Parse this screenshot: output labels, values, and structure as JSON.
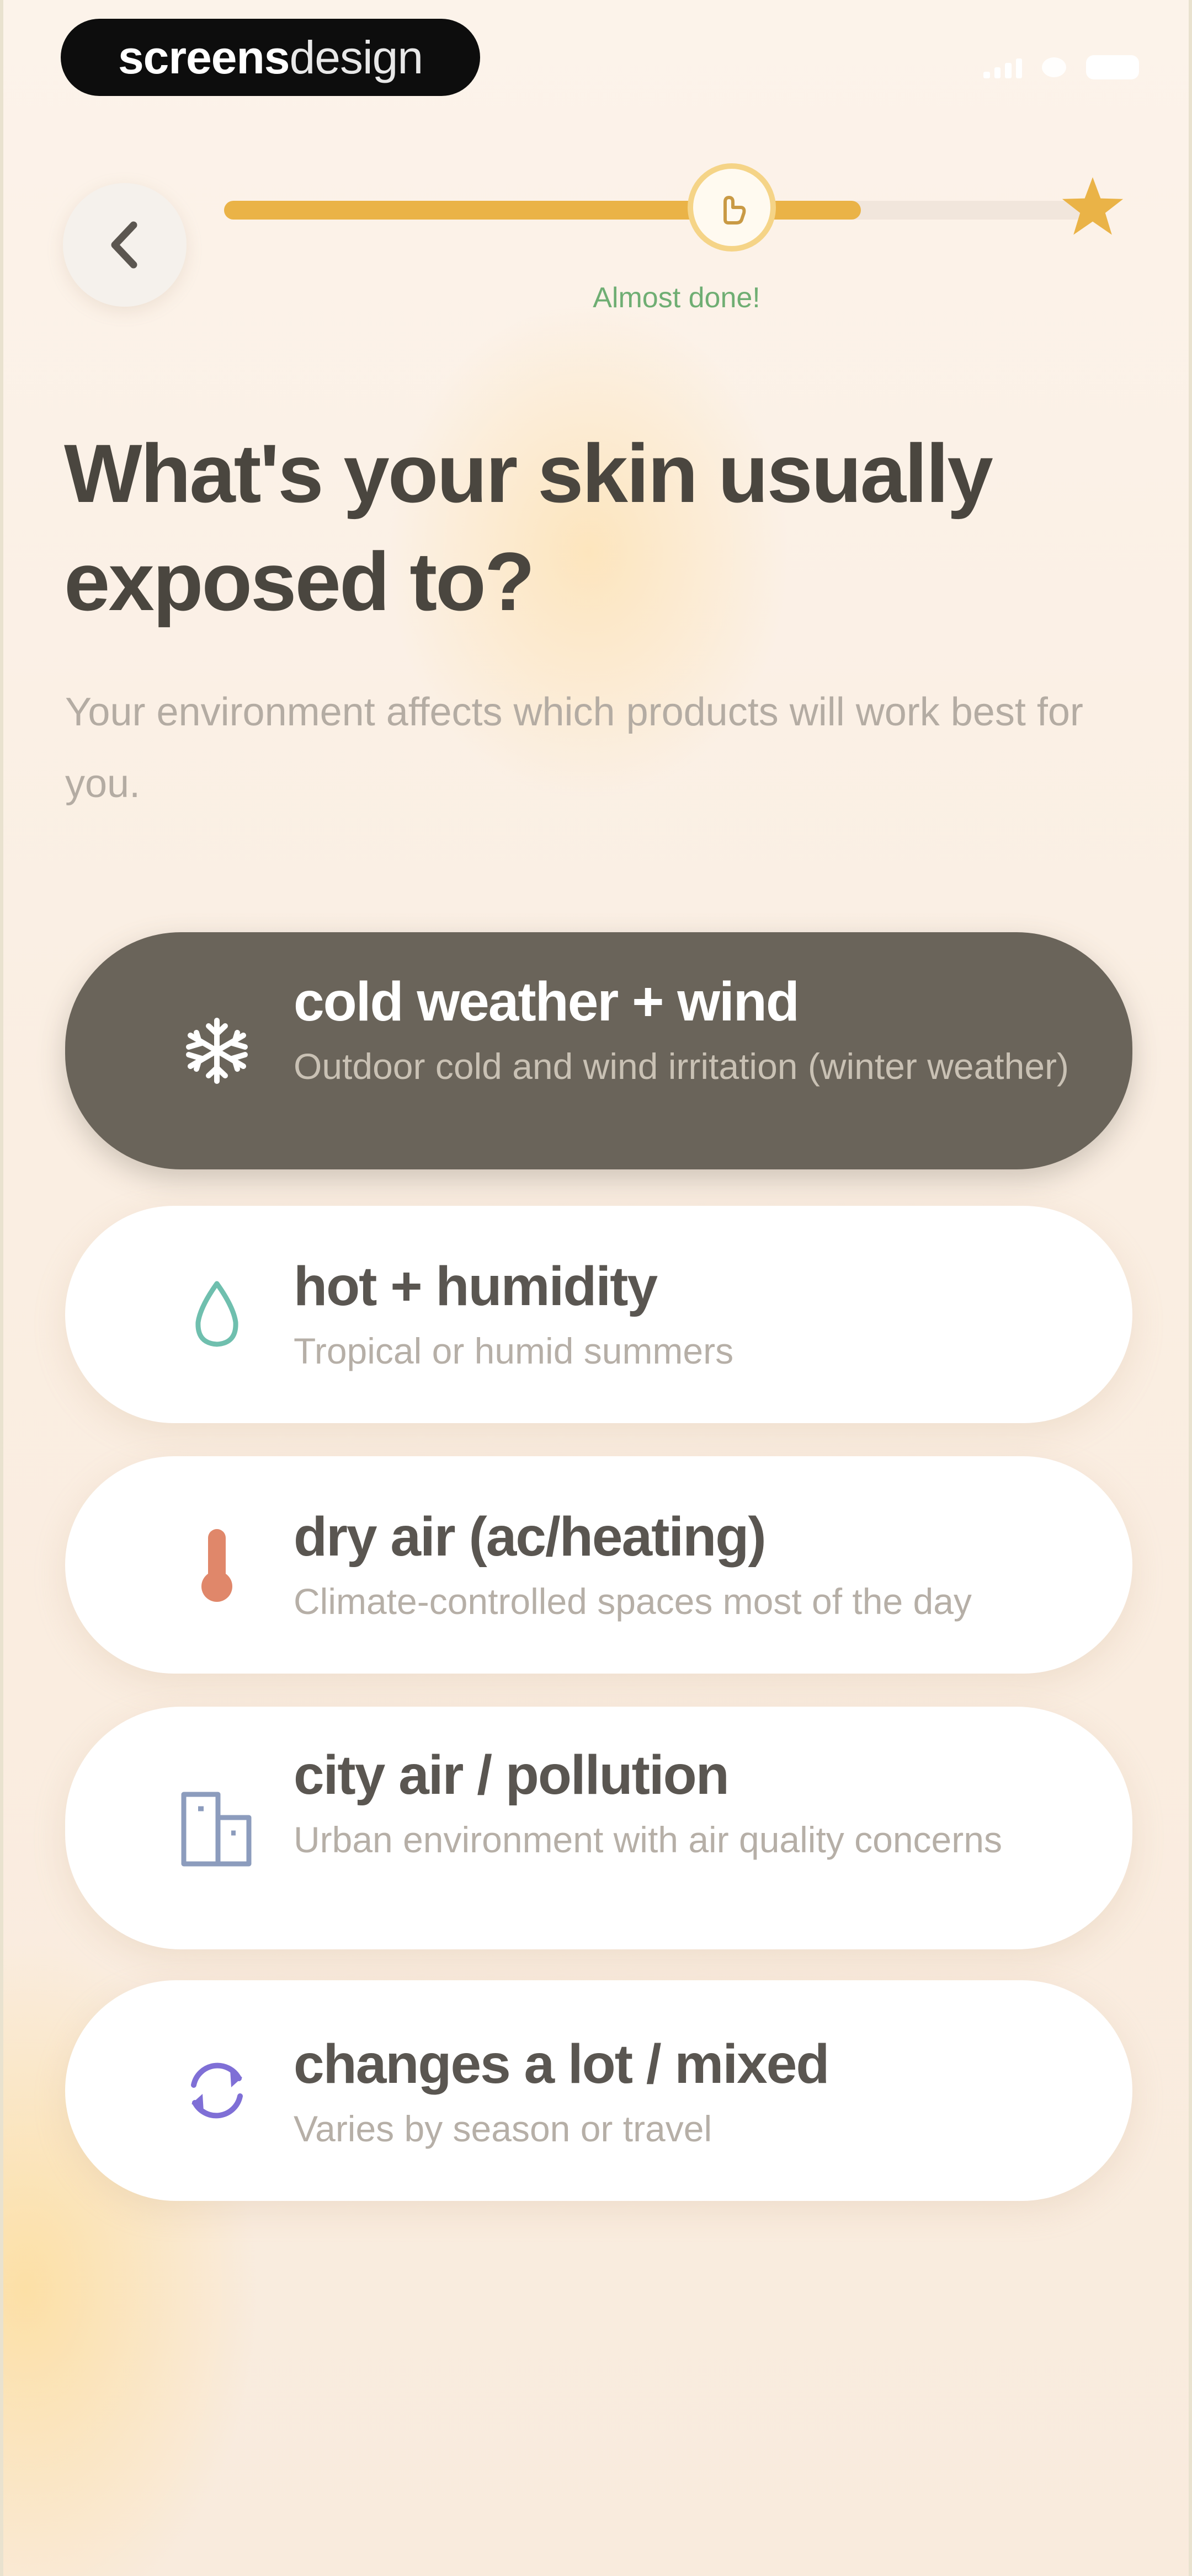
{
  "watermark": {
    "bold": "screens",
    "light": "design"
  },
  "header": {
    "back_icon": "chevron-left-icon"
  },
  "progress": {
    "fraction": 0.74,
    "caption": "Almost done!",
    "marker_icon": "hand-icon",
    "goal_icon": "star-icon",
    "accent": "#eab347"
  },
  "main": {
    "title": "What's your skin usually exposed to?",
    "subtitle": "Your environment affects which products will work best for you."
  },
  "options": [
    {
      "title": "cold weather + wind",
      "description": "Outdoor cold and wind irritation (winter weather)",
      "icon": "snowflake-icon",
      "selected": true
    },
    {
      "title": "hot + humidity",
      "description": "Tropical or humid summers",
      "icon": "droplet-icon",
      "selected": false
    },
    {
      "title": "dry air (ac/heating)",
      "description": "Climate-controlled spaces most of the day",
      "icon": "thermometer-icon",
      "selected": false
    },
    {
      "title": "city air / pollution",
      "description": "Urban environment with air quality concerns",
      "icon": "buildings-icon",
      "selected": false
    },
    {
      "title": "changes a lot / mixed",
      "description": "Varies by season or travel",
      "icon": "refresh-icon",
      "selected": false
    }
  ],
  "colors": {
    "selected_card": "#6a645a",
    "title_text": "#4a463f",
    "caption_green": "#6fae73"
  }
}
